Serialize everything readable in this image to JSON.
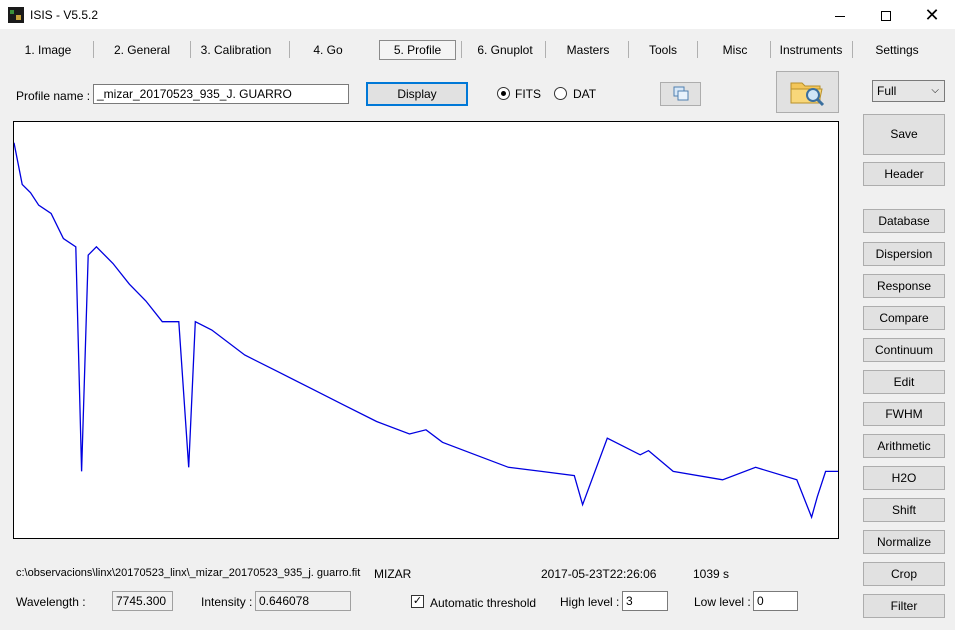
{
  "window": {
    "title": "ISIS - V5.5.2",
    "icon": "isis-app-icon",
    "min_icon": "minimize-icon",
    "max_icon": "maximize-icon",
    "close_icon": "close-icon",
    "close_glyph": "✕"
  },
  "tabs": [
    {
      "label": "1. Image"
    },
    {
      "label": "2. General"
    },
    {
      "label": "3. Calibration"
    },
    {
      "label": "4. Go"
    },
    {
      "label": "5. Profile"
    },
    {
      "label": "6. Gnuplot"
    },
    {
      "label": "Masters"
    },
    {
      "label": "Tools"
    },
    {
      "label": "Misc"
    },
    {
      "label": "Instruments"
    },
    {
      "label": "Settings"
    }
  ],
  "profile": {
    "name_label": "Profile name :",
    "name_value": "_mizar_20170523_935_J. GUARRO",
    "display_button": "Display",
    "format_fits": "FITS",
    "format_dat": "DAT",
    "copy_icon": "copy-icon",
    "open_icon": "folder-search-icon"
  },
  "side": {
    "zoom_select": "Full",
    "chevron": "⌵",
    "buttons": [
      "Save",
      "Header",
      "Database",
      "Dispersion",
      "Response",
      "Compare",
      "Continuum",
      "Edit",
      "FWHM",
      "Arithmetic",
      "H2O",
      "Shift",
      "Normalize",
      "Crop",
      "Filter"
    ]
  },
  "status": {
    "path": "c:\\observacions\\linx\\20170523_linx\\_mizar_20170523_935_j. guarro.fit",
    "object": "MIZAR",
    "date": "2017-05-23T22:26:06",
    "exposure": "1039 s",
    "wavelength_label": "Wavelength :",
    "wavelength_value": "7745.300",
    "intensity_label": "Intensity :",
    "intensity_value": "0.646078",
    "auto_threshold_label": "Automatic threshold",
    "auto_threshold_checked": true,
    "check_glyph": "✓",
    "high_label": "High level :",
    "high_value": "3",
    "low_label": "Low level :",
    "low_value": "0"
  },
  "chart_data": {
    "type": "line",
    "series_color": "#0000e0",
    "x": [
      0.0,
      0.01,
      0.02,
      0.03,
      0.045,
      0.06,
      0.075,
      0.082,
      0.09,
      0.1,
      0.12,
      0.14,
      0.16,
      0.18,
      0.2,
      0.212,
      0.22,
      0.24,
      0.28,
      0.32,
      0.36,
      0.4,
      0.44,
      0.48,
      0.5,
      0.52,
      0.56,
      0.6,
      0.64,
      0.68,
      0.69,
      0.72,
      0.76,
      0.77,
      0.8,
      0.86,
      0.9,
      0.95,
      0.968,
      0.975,
      0.985,
      1.0
    ],
    "y": [
      0.95,
      0.85,
      0.83,
      0.8,
      0.78,
      0.72,
      0.7,
      0.16,
      0.68,
      0.7,
      0.66,
      0.61,
      0.57,
      0.52,
      0.52,
      0.17,
      0.52,
      0.5,
      0.44,
      0.4,
      0.36,
      0.32,
      0.28,
      0.25,
      0.26,
      0.23,
      0.2,
      0.17,
      0.16,
      0.15,
      0.08,
      0.24,
      0.2,
      0.21,
      0.16,
      0.14,
      0.17,
      0.14,
      0.05,
      0.1,
      0.16,
      0.16
    ]
  }
}
